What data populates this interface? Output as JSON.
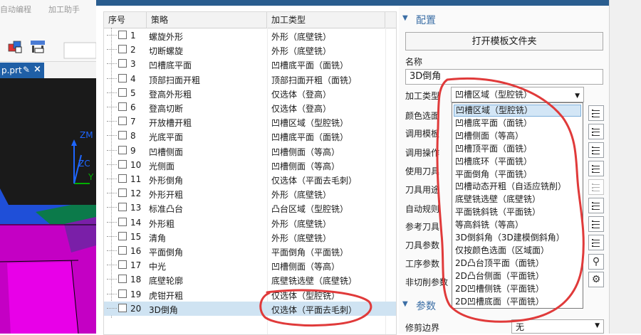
{
  "background_app": {
    "menu": [
      "自动编程",
      "加工助手"
    ],
    "file_tab": "p.prt"
  },
  "table": {
    "headers": [
      "序号",
      "策略",
      "加工类型"
    ],
    "rows": [
      {
        "num": "1",
        "name": "螺旋外形",
        "type": "外形（底壁铣）"
      },
      {
        "num": "2",
        "name": "切断螺旋",
        "type": "外形（底壁铣）"
      },
      {
        "num": "3",
        "name": "凹槽底平面",
        "type": "凹槽底平面（面铣）"
      },
      {
        "num": "4",
        "name": "顶部扫面开粗",
        "type": "顶部扫面开粗（面铣）"
      },
      {
        "num": "5",
        "name": "登高外形粗",
        "type": "仅选体（登高）"
      },
      {
        "num": "6",
        "name": "登高切断",
        "type": "仅选体（登高）"
      },
      {
        "num": "7",
        "name": "开放槽开粗",
        "type": "凹槽区域（型腔铣）"
      },
      {
        "num": "8",
        "name": "光底平面",
        "type": "凹槽底平面（面铣）"
      },
      {
        "num": "9",
        "name": "凹槽侧面",
        "type": "凹槽侧面（等高）"
      },
      {
        "num": "10",
        "name": "光侧面",
        "type": "凹槽侧面（等高）"
      },
      {
        "num": "11",
        "name": "外形倒角",
        "type": "仅选体（平面去毛刺）"
      },
      {
        "num": "12",
        "name": "外形开粗",
        "type": "外形（底壁铣）"
      },
      {
        "num": "13",
        "name": "标准凸台",
        "type": "凸台区域（型腔铣）"
      },
      {
        "num": "14",
        "name": "外形粗",
        "type": "外形（底壁铣）"
      },
      {
        "num": "15",
        "name": "清角",
        "type": "外形（底壁铣）"
      },
      {
        "num": "16",
        "name": "平面倒角",
        "type": "平面倒角（平面铣）"
      },
      {
        "num": "17",
        "name": "中光",
        "type": "凹槽侧面（等高）"
      },
      {
        "num": "18",
        "name": "底壁轮廓",
        "type": "底壁铣选壁（底壁铣）"
      },
      {
        "num": "19",
        "name": "虎钳开粗",
        "type": "仅选体（型腔铣）"
      },
      {
        "num": "20",
        "name": "3D倒角",
        "type": "仅选体（平面去毛刺）"
      }
    ],
    "selected_index": 19
  },
  "panel": {
    "config_title": "配置",
    "open_folder_button": "打开模板文件夹",
    "name_label": "名称",
    "name_value": "3D倒角",
    "type_label": "加工类型",
    "type_value": "凹槽区域（型腔铣）",
    "labels": [
      "颜色选面",
      "调用模板",
      "调用操作",
      "使用刀具",
      "刀具用途",
      "自动规则",
      "参考刀具",
      "刀具参数",
      "工序参数",
      "非切削参数"
    ],
    "params_title": "参数",
    "clip_label": "修剪边界",
    "clip_value": "无"
  },
  "dropdown": {
    "options": [
      "凹槽区域（型腔铣）",
      "凹槽底平面（面铣）",
      "凹槽侧面（等高）",
      "凹槽顶平面（面铣）",
      "凹槽底环（平面铣）",
      "平面倒角（平面铣）",
      "凹槽动态开粗（自适应铣削）",
      "底壁铣选壁（底壁铣）",
      "平面铣斜铣（平面铣）",
      "等高斜铣（等高）",
      "3D倒斜角（3D建模倒斜角）",
      "仅按颜色选面（区域面）",
      "2D凸台顶平面（面铣）",
      "2D凸台侧面（平面铣）",
      "2D凹槽侧铣（平面铣）",
      "2D凹槽底面（平面铣）"
    ],
    "highlighted_index": 0
  },
  "viewport": {
    "axis_labels": [
      "ZM",
      "ZC",
      "Y"
    ]
  },
  "colors": {
    "selection": "#cfe3f2",
    "accent": "#3b6ea5",
    "annotation": "#e03a3a",
    "model_magenta": "#d000d0",
    "model_blue": "#1e50e6"
  }
}
